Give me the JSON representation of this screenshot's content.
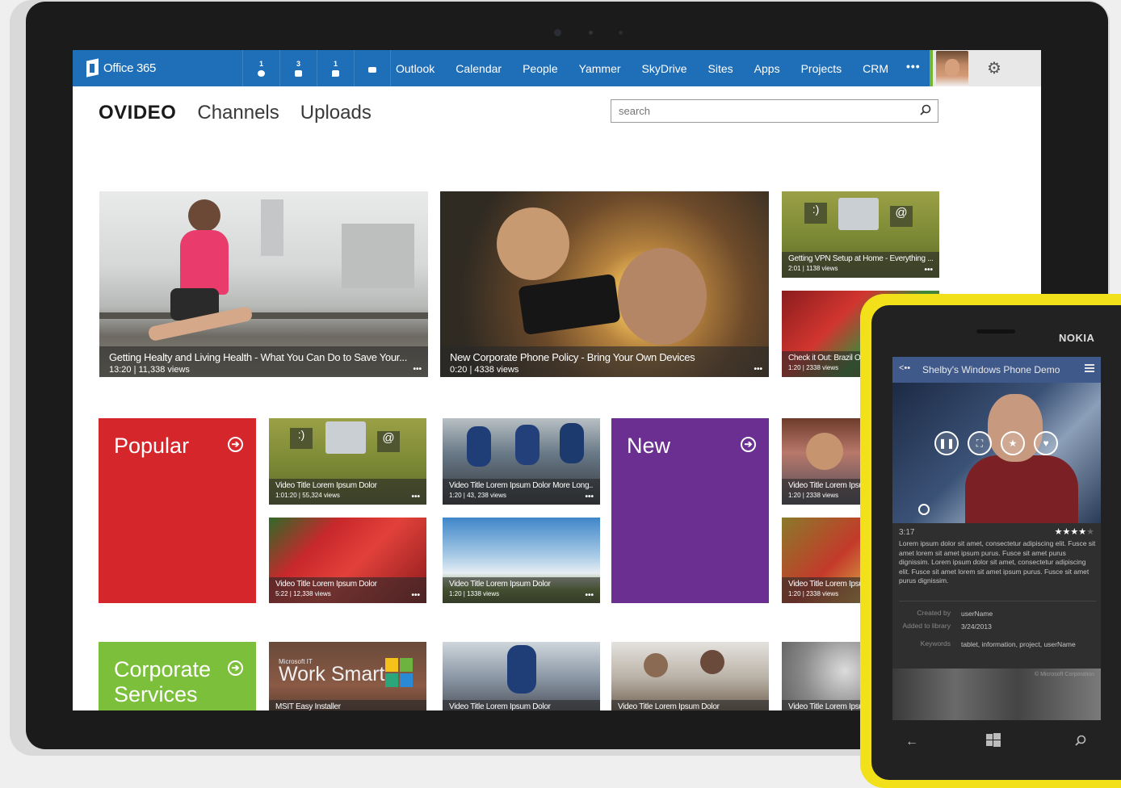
{
  "colors": {
    "suite_bar": "#1e6eb8",
    "popular": "#d5262b",
    "new": "#6a2f91",
    "corporate": "#7cbf3b",
    "phone_shell": "#f2e01a",
    "phone_appbar": "#3f5a8a"
  },
  "suite_bar": {
    "logo_label": "Office 365",
    "notifications": [
      {
        "count": "1",
        "icon": "alert-icon"
      },
      {
        "count": "3",
        "icon": "calendar-icon"
      },
      {
        "count": "1",
        "icon": "chat-icon"
      },
      {
        "count": "",
        "icon": "mail-icon"
      }
    ],
    "nav": [
      "Outlook",
      "Calendar",
      "People",
      "Yammer",
      "SkyDrive",
      "Sites",
      "Apps",
      "Projects",
      "CRM"
    ],
    "more_label": "•••"
  },
  "header": {
    "brand": "OVIDEO",
    "links": [
      "Channels",
      "Uploads"
    ],
    "search_placeholder": "search"
  },
  "featured": [
    {
      "title": "Getting Healty and Living Health - What You Can Do to Save Your...",
      "meta": "13:20  |  11,338 views",
      "more": "•••"
    },
    {
      "title": "New Corporate Phone Policy - Bring Your Own Devices",
      "meta": "0:20  |  4338 views",
      "more": "•••"
    },
    {
      "title": "Getting VPN Setup at Home - Everything ...",
      "meta": "2:01  |  1138 views",
      "more": "•••"
    },
    {
      "title": "Check it Out: Brazil Of",
      "meta": "1:20  |  2338 views",
      "more": "•••"
    }
  ],
  "categories": {
    "popular": "Popular",
    "new": "New",
    "corporate": "Corporate Services",
    "arrow": "➔"
  },
  "grid": [
    {
      "title": "Video Title Lorem Ipsum Dolor",
      "meta": "1:01:20  |  55,324 views",
      "more": "•••"
    },
    {
      "title": "Video Title Lorem Ipsum Dolor More Long...",
      "meta": "1:20  |  43, 238 views",
      "more": "•••"
    },
    {
      "title": "Video Title Lorem Ipsu",
      "meta": "1:20  |  2338 views",
      "more": "•••"
    },
    {
      "title": "Video Title Lorem Ipsum Dolor",
      "meta": "5:22  |  12,338 views",
      "more": "•••"
    },
    {
      "title": "Video Title Lorem Ipsum Dolor",
      "meta": "1:20  |  1338 views",
      "more": "•••"
    },
    {
      "title": "Video Title Lorem Ipsu",
      "meta": "1:20  |  2338 views",
      "more": "•••"
    }
  ],
  "bottom_row": [
    {
      "title": "MSIT Easy Installer",
      "overlay": "Work Smart",
      "overlay_small": "Microsoft IT"
    },
    {
      "title": "Video Title Lorem Ipsum Dolor"
    },
    {
      "title": "Video Title Lorem Ipsum Dolor"
    },
    {
      "title": "Video Title Lorem Ipsu"
    }
  ],
  "phone": {
    "brand": "NOKIA",
    "app_title": "Shelby's Windows Phone Demo",
    "duration": "3:17",
    "rating": 3.5,
    "rating_max": 5,
    "description": "Lorem ipsum dolor sit amet, consectetur adipiscing elit. Fusce sit amet lorem sit amet ipsum purus. Fusce sit amet purus dignissim. Lorem ipsum dolor sit amet, consectetur adipiscing elit. Fusce sit amet lorem sit amet ipsum purus. Fusce sit amet purus dignissim.",
    "meta": [
      {
        "label": "Created by",
        "value": "userName"
      },
      {
        "label": "Added to library",
        "value": "3/24/2013"
      },
      {
        "label": "Keywords",
        "value": "tablet, information, project, userName"
      }
    ],
    "copyright": "© Microsoft Corporation"
  }
}
